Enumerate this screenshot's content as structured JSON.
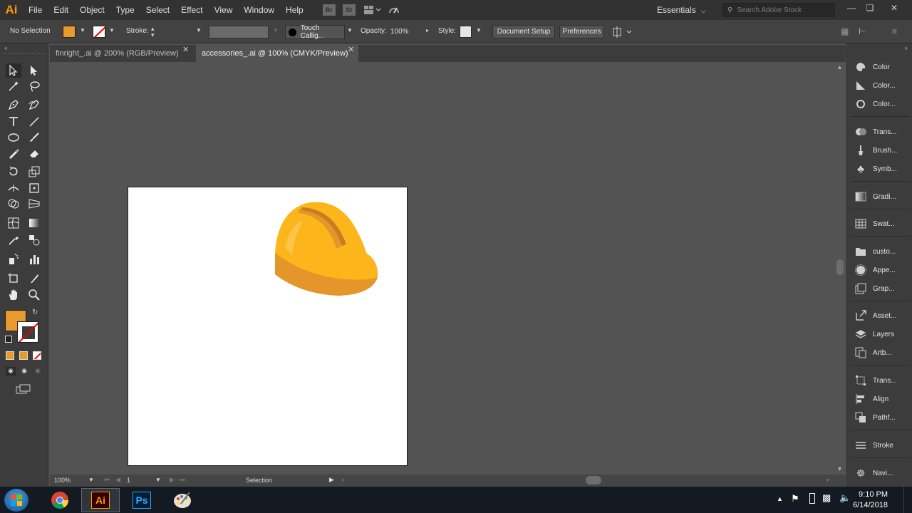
{
  "app": {
    "logo": "Ai"
  },
  "menu": [
    "File",
    "Edit",
    "Object",
    "Type",
    "Select",
    "Effect",
    "View",
    "Window",
    "Help"
  ],
  "menu_icons": [
    "Br",
    "St"
  ],
  "workspace": "Essentials",
  "search": {
    "placeholder": "Search Adobe Stock"
  },
  "control": {
    "selection": "No Selection",
    "stroke_label": "Stroke:",
    "brush": "Touch Callig...",
    "opacity_label": "Opacity:",
    "opacity_value": "100%",
    "style_label": "Style:",
    "doc_setup": "Document Setup",
    "preferences": "Preferences",
    "fill_color": "#e89a2c"
  },
  "tabs": [
    {
      "label": "finright_.ai @ 200% (RGB/Preview)",
      "active": false
    },
    {
      "label": "accessories_.ai @ 100% (CMYK/Preview)",
      "active": true
    }
  ],
  "panels": [
    "Color",
    "Color...",
    "Color...",
    "Trans...",
    "Brush...",
    "Symb...",
    "Gradi...",
    "Swat...",
    "custo...",
    "Appe...",
    "Grap...",
    "Asset...",
    "Layers",
    "Artb...",
    "Trans...",
    "Align",
    "Pathf...",
    "Stroke",
    "Navi..."
  ],
  "status": {
    "zoom": "100%",
    "artboard": "1",
    "tool": "Selection"
  },
  "taskbar": {
    "time": "9:10 PM",
    "date": "6/14/2018",
    "apps": [
      "Chrome",
      "Ai",
      "Ps",
      "Paint"
    ]
  },
  "colors": {
    "hardhat_main": "#fcb51a",
    "hardhat_shadow": "#e4962a",
    "accent": "#ff9a00"
  }
}
